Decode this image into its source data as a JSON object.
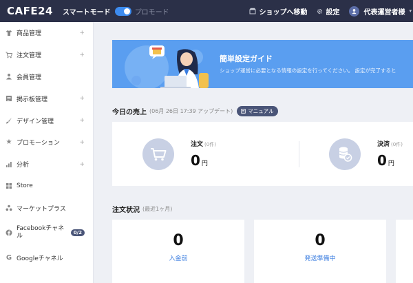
{
  "header": {
    "logo": "CAFE24",
    "smart_mode": "スマートモード",
    "pro_mode": "プロモード",
    "shop_link": "ショップへ移動",
    "settings": "設定",
    "user": "代表運営者様"
  },
  "sidebar": {
    "items": [
      {
        "label": "商品管理",
        "icon": "shirt-icon",
        "expandable": true
      },
      {
        "label": "注文管理",
        "icon": "cart-icon",
        "expandable": true
      },
      {
        "label": "会員管理",
        "icon": "person-icon",
        "expandable": false
      },
      {
        "label": "掲示板管理",
        "icon": "board-icon",
        "expandable": true
      },
      {
        "label": "デザイン管理",
        "icon": "brush-icon",
        "expandable": true
      },
      {
        "label": "プロモーション",
        "icon": "star-icon",
        "expandable": true
      },
      {
        "label": "分析",
        "icon": "chart-icon",
        "expandable": true
      },
      {
        "label": "Store",
        "icon": "grid-icon",
        "expandable": false
      },
      {
        "label": "マーケットプラス",
        "icon": "cluster-icon",
        "expandable": false
      },
      {
        "label": "Facebookチャネル",
        "icon": "facebook-icon",
        "badge": "0/2"
      },
      {
        "label": "Googleチャネル",
        "icon": "google-icon",
        "expandable": false
      }
    ]
  },
  "banner": {
    "title": "簡単設定ガイド",
    "subtitle": "ショップ運営に必要となる情報の設定を行ってください。 設定が完了すると"
  },
  "today_sales": {
    "title": "今日の売上",
    "date": "(06月 26日 17:39 アップデート)",
    "manual": "マニュアル",
    "order": {
      "label": "注文",
      "count": "(0件)",
      "value": "0",
      "unit": "円"
    },
    "payment": {
      "label": "決済",
      "count": "(0件)",
      "value": "0",
      "unit": "円"
    }
  },
  "order_status": {
    "title": "注文状況",
    "period": "(最近1ヶ月)",
    "cards": [
      {
        "value": "0",
        "label": "入金前"
      },
      {
        "value": "0",
        "label": "発送準備中"
      }
    ]
  },
  "colors": {
    "topbar": "#2b3048",
    "banner": "#5a9ef0",
    "link": "#3a7de0",
    "toggle": "#3d8cf0"
  }
}
